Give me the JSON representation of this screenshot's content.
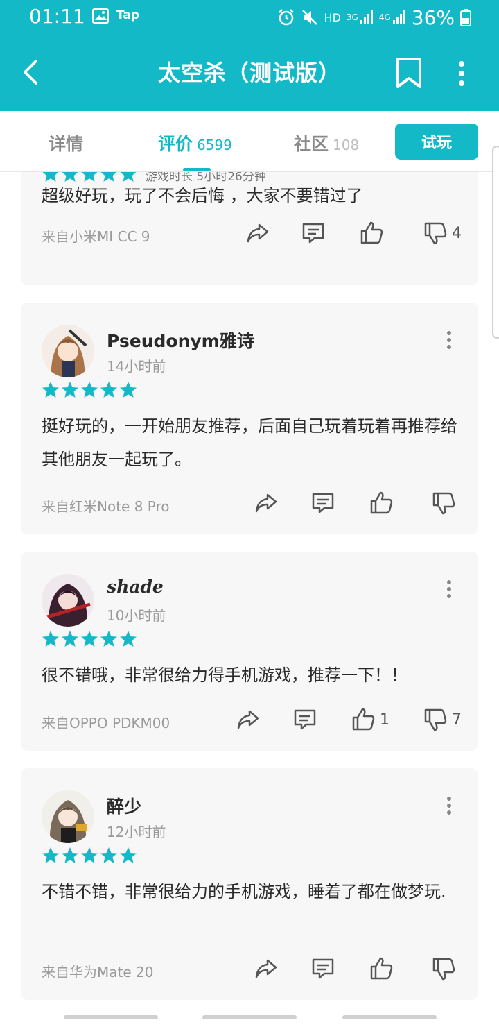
{
  "status_bar": {
    "time": "01:11",
    "app_badge": "Tap",
    "network_hd": "HD",
    "network_3g": "3G",
    "network_4g": "4G",
    "battery": "36%"
  },
  "header": {
    "title": "太空杀（测试版）"
  },
  "tabs": [
    {
      "label": "详情",
      "count": ""
    },
    {
      "label": "评价",
      "count": "6599"
    },
    {
      "label": "社区",
      "count": "108"
    }
  ],
  "trial_button": "试玩",
  "colors": {
    "accent": "#14b9c8"
  },
  "reviews": [
    {
      "partial_meta": "游戏时长 5小时26分钟",
      "rating": 5,
      "text": "超级好玩，玩了不会后悔 ，大家不要错过了",
      "device": "来自小米MI CC 9",
      "likes": "",
      "dislikes": "4"
    },
    {
      "name": "Pseudonym雅诗",
      "time": "14小时前",
      "rating": 5,
      "text": "挺好玩的，一开始朋友推荐，后面自己玩着玩着再推荐给其他朋友一起玩了。",
      "device": "来自红米Note 8 Pro",
      "likes": "",
      "dislikes": ""
    },
    {
      "name": "shade",
      "time": "10小时前",
      "rating": 5,
      "text": "很不错哦，非常很给力得手机游戏，推荐一下！！",
      "device": "来自OPPO PDKM00",
      "likes": "1",
      "dislikes": "7"
    },
    {
      "name": "醉少",
      "time": "12小时前",
      "rating": 5,
      "text": "不错不错，非常很给力的手机游戏，睡着了都在做梦玩.",
      "device": "来自华为Mate 20",
      "likes": "",
      "dislikes": ""
    }
  ]
}
